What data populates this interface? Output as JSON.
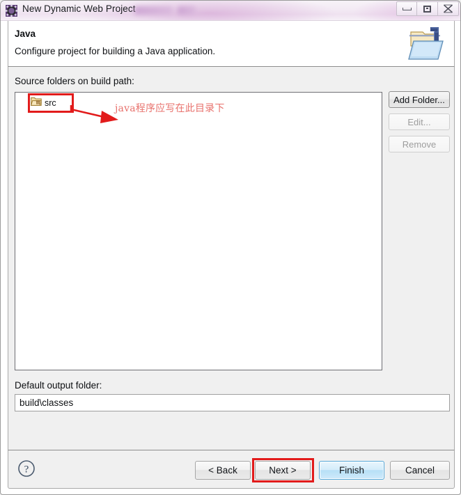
{
  "window": {
    "title": "New Dynamic Web Project",
    "app_icon": "eclipse-gear-icon",
    "redacted_note": "blurred text after title",
    "controls": {
      "minimize": "minimize-icon",
      "maximize": "maximize-icon",
      "close": "close-icon"
    }
  },
  "header": {
    "title": "Java",
    "description": "Configure project for building a Java application.",
    "banner_icon": "java-folder-icon"
  },
  "main": {
    "source_label": "Source folders on build path:",
    "tree": [
      {
        "icon": "source-folder-icon",
        "label": "src"
      }
    ],
    "annotation": {
      "text": "java程序应写在此目录下",
      "color": "#e8716c",
      "box_color": "#e21b1b"
    },
    "buttons": [
      {
        "label": "Add Folder...",
        "enabled": true
      },
      {
        "label": "Edit...",
        "enabled": false
      },
      {
        "label": "Remove",
        "enabled": false
      }
    ],
    "output_label": "Default output folder:",
    "output_value": "build\\classes",
    "output_placeholder": ""
  },
  "footer": {
    "help_icon": "help-question-icon",
    "back_label": "< Back",
    "next_label": "Next >",
    "finish_label": "Finish",
    "cancel_label": "Cancel",
    "next_highlight_color": "#e21b1b",
    "finish_is_default": true
  }
}
